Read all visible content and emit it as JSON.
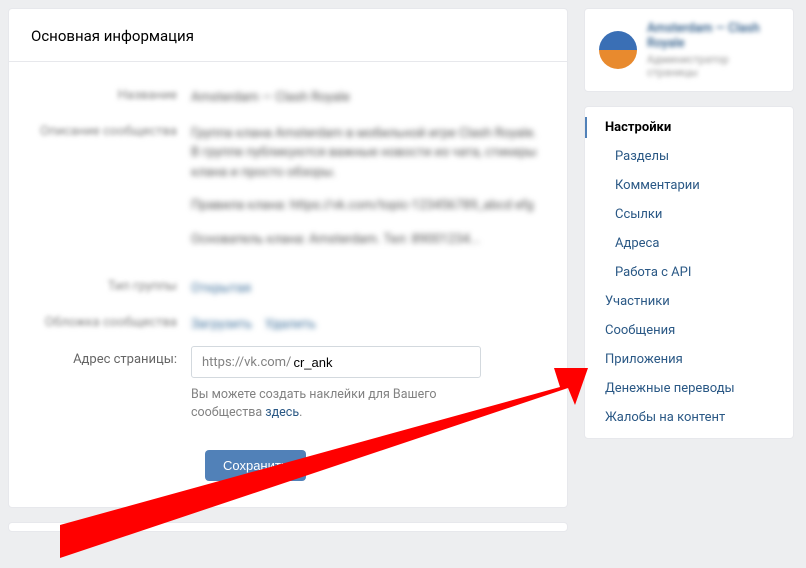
{
  "header": {
    "title": "Основная информация"
  },
  "form": {
    "labels": {
      "name": "Название",
      "desc": "Описание сообщества",
      "type": "Тип группы",
      "cover": "Обложка сообщества",
      "address": "Адрес страницы:"
    },
    "name_val": "Amsterdam — Clash Royale",
    "desc_val": {
      "p1": "Группа клана Amsterdam в мобильной игре Clash Royale. В группе публикуются важные новости из чата, стикеры клана и просто обзоры.",
      "p2": "Правила клана: https://vk.com/topic-123456789_abcd efg",
      "p3": "Основатель клана: Amsterdam. Тел: 89001234..."
    },
    "type_val": "Открытая",
    "cover_val": {
      "a": "Загрузить",
      "b": "Удалить"
    },
    "url_prefix": "https://vk.com/",
    "url_value": "cr_ank",
    "hint_text": "Вы можете создать наклейки для Вашего сообщества ",
    "hint_link": "здесь",
    "hint_tail": ".",
    "save": "Сохранить"
  },
  "profile": {
    "title": "Amsterdam — Clash Royale",
    "sub": "Администратор страницы"
  },
  "nav": {
    "settings": "Настройки",
    "sections": "Разделы",
    "comments": "Комментарии",
    "links": "Ссылки",
    "addresses": "Адреса",
    "api": "Работа с API",
    "members": "Участники",
    "messages": "Сообщения",
    "apps": "Приложения",
    "transfers": "Денежные переводы",
    "reports": "Жалобы на контент"
  }
}
